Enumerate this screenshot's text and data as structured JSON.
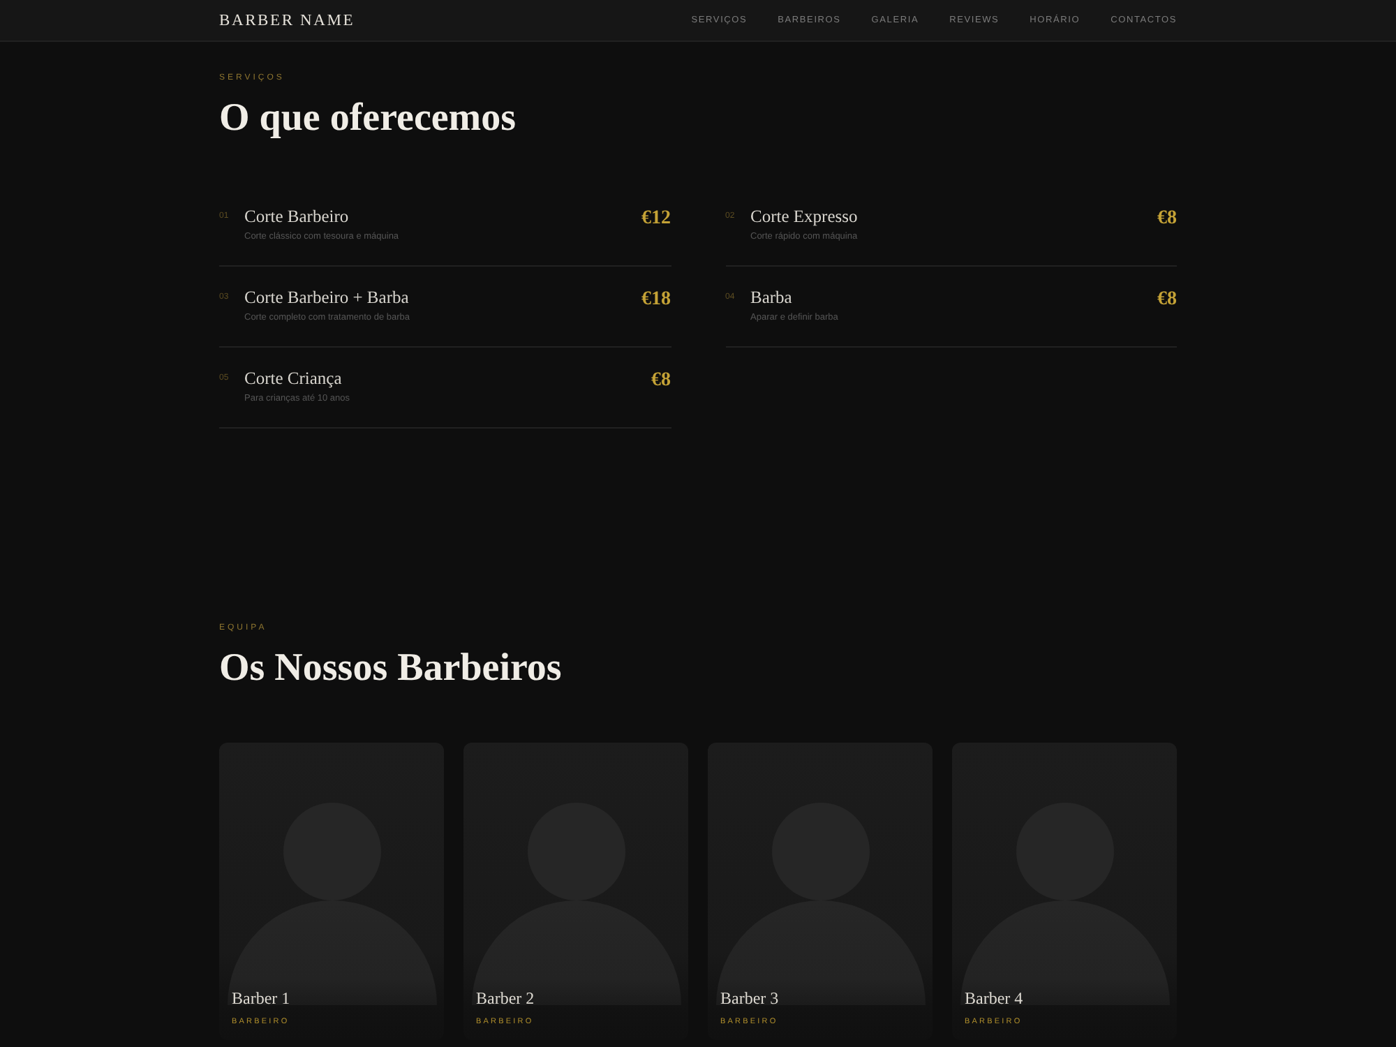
{
  "nav": {
    "brand": "BARBER NAME",
    "links": [
      {
        "label": "SERVIÇOS"
      },
      {
        "label": "BARBEIROS"
      },
      {
        "label": "GALERIA"
      },
      {
        "label": "REVIEWS"
      },
      {
        "label": "HORÁRIO"
      },
      {
        "label": "CONTACTOS"
      }
    ]
  },
  "services": {
    "eyebrow": "SERVIÇOS",
    "title": "O que oferecemos",
    "items": [
      {
        "number": "01",
        "name": "Corte Barbeiro",
        "description": "Corte clássico com tesoura e máquina",
        "price": "€12"
      },
      {
        "number": "02",
        "name": "Corte Expresso",
        "description": "Corte rápido com máquina",
        "price": "€8"
      },
      {
        "number": "03",
        "name": "Corte Barbeiro + Barba",
        "description": "Corte completo com tratamento de barba",
        "price": "€18"
      },
      {
        "number": "04",
        "name": "Barba",
        "description": "Aparar e definir barba",
        "price": "€8"
      },
      {
        "number": "05",
        "name": "Corte Criança",
        "description": "Para crianças até 10 anos",
        "price": "€8"
      }
    ]
  },
  "team": {
    "eyebrow": "EQUIPA",
    "title": "Os Nossos Barbeiros",
    "members": [
      {
        "name": "Barber 1",
        "role": "BARBEIRO"
      },
      {
        "name": "Barber 2",
        "role": "BARBEIRO"
      },
      {
        "name": "Barber 3",
        "role": "BARBEIRO"
      },
      {
        "name": "Barber 4",
        "role": "BARBEIRO"
      }
    ]
  }
}
